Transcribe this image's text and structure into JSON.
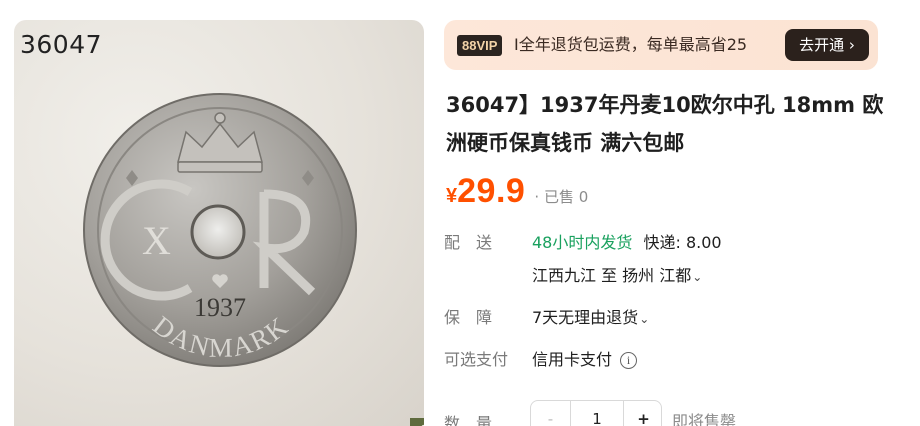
{
  "image": {
    "id_label": "36047",
    "coin_year": "1937",
    "coin_country": "DANMARK",
    "coin_monogram_left": "X",
    "corner_thumb_icon": "flower-icon"
  },
  "vip": {
    "badge": "88VIP",
    "text": "I全年退货包运费，每单最高省25",
    "button": "去开通",
    "button_chevron": "›"
  },
  "product": {
    "title": "36047】1937年丹麦10欧尔中孔 18mm 欧洲硬币保真钱币 满六包邮",
    "price_symbol": "¥",
    "price": "29.9",
    "sold": "· 已售 0"
  },
  "shipping": {
    "label": "配　送",
    "speed": "48小时内发货",
    "fee": "快递: 8.00",
    "route": "江西九江  至  扬州 江都",
    "chevron": "⌄"
  },
  "guarantee": {
    "label": "保　障",
    "value": "7天无理由退货",
    "chevron": "⌄"
  },
  "payment": {
    "label": "可选支付",
    "value": "信用卡支付",
    "info_icon": "i"
  },
  "quantity": {
    "label": "数　量",
    "minus": "-",
    "value": "1",
    "plus": "+",
    "status": "即将售罄"
  },
  "colors": {
    "price": "#ff5000",
    "green": "#1aa15f",
    "vip_button": "#2b211c"
  }
}
